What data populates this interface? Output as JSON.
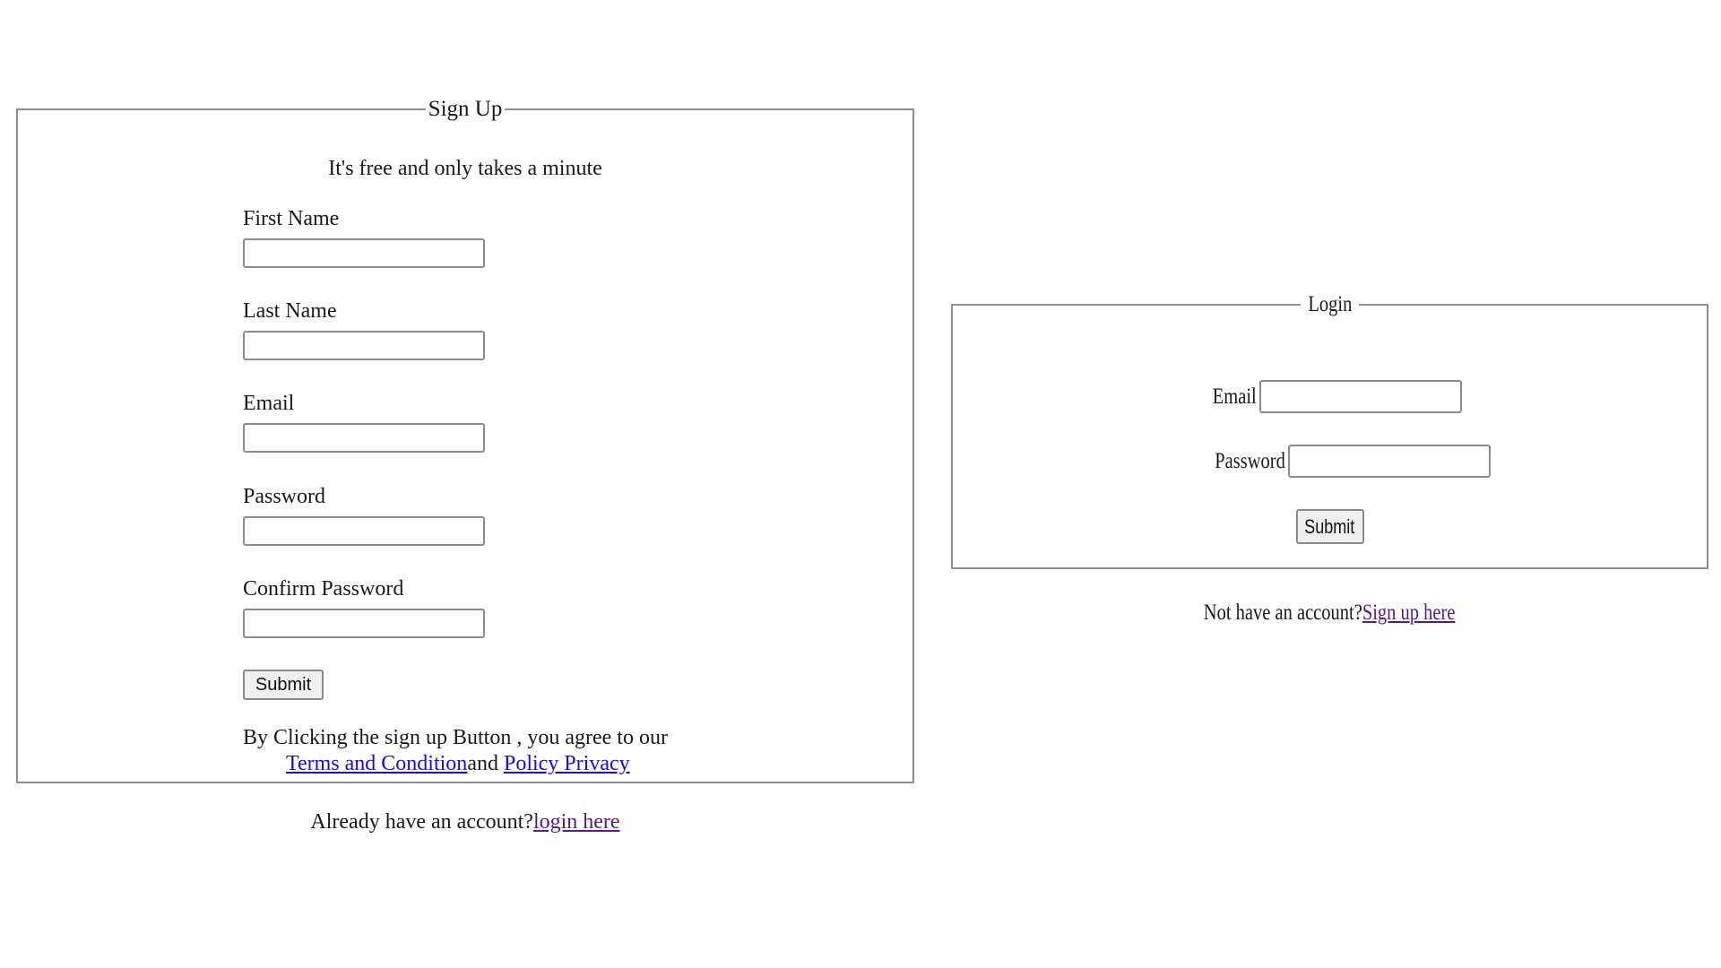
{
  "signup": {
    "legend": "Sign Up",
    "subtitle": "It's free and only takes a minute",
    "fields": [
      {
        "label": "First Name",
        "value": ""
      },
      {
        "label": "Last Name",
        "value": ""
      },
      {
        "label": "Email",
        "value": ""
      },
      {
        "label": "Password",
        "value": ""
      },
      {
        "label": "Confirm Password",
        "value": ""
      }
    ],
    "submit_label": "Submit",
    "terms_text": "By Clicking the sign up Button , you agree to our",
    "terms_link": "Terms and Condition",
    "terms_and": "and",
    "privacy_link": "Policy Privacy",
    "footer_text": "Already have an account?",
    "footer_link": "login here"
  },
  "login": {
    "legend": "Login",
    "email_label": "Email",
    "email_value": "",
    "password_label": "Password",
    "password_value": "",
    "submit_label": "Submit",
    "footer_text": "Not have an account?",
    "footer_link": "Sign up here"
  },
  "colors": {
    "link": "#1a0dcc",
    "visited_link": "#551a8b",
    "border": "#8f8f8f"
  }
}
